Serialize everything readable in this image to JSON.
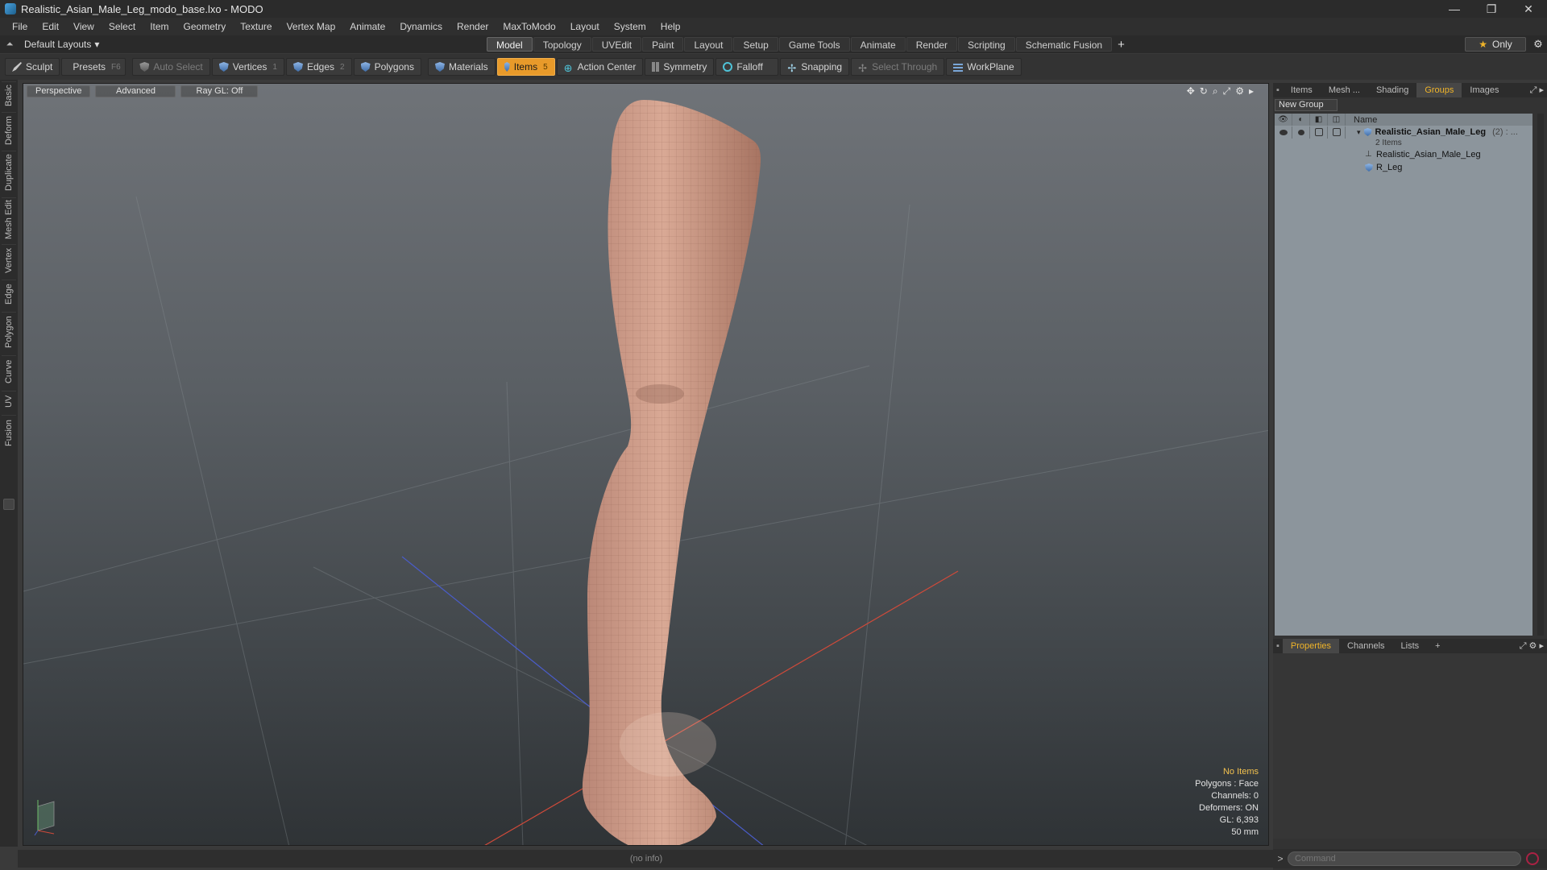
{
  "window": {
    "title": "Realistic_Asian_Male_Leg_modo_base.lxo - MODO",
    "controls": {
      "minimize": "—",
      "maximize": "❐",
      "close": "✕"
    }
  },
  "menu": [
    "File",
    "Edit",
    "View",
    "Select",
    "Item",
    "Geometry",
    "Texture",
    "Vertex Map",
    "Animate",
    "Dynamics",
    "Render",
    "MaxToModo",
    "Layout",
    "System",
    "Help"
  ],
  "layoutbar": {
    "layout_select": "Default Layouts",
    "tabs": [
      "Model",
      "Topology",
      "UVEdit",
      "Paint",
      "Layout",
      "Setup",
      "Game Tools",
      "Animate",
      "Render",
      "Scripting",
      "Schematic Fusion"
    ],
    "active_tab": "Model",
    "add_tab": "+",
    "only_label": "Only"
  },
  "toolbar": {
    "sculpt": "Sculpt",
    "presets": "Presets",
    "presets_key": "F6",
    "auto_select": "Auto Select",
    "vertices": "Vertices",
    "vertices_key": "1",
    "edges": "Edges",
    "edges_key": "2",
    "polygons": "Polygons",
    "materials": "Materials",
    "items": "Items",
    "items_key": "5",
    "action_center": "Action Center",
    "symmetry": "Symmetry",
    "falloff": "Falloff",
    "snapping": "Snapping",
    "select_through": "Select Through",
    "workplane": "WorkPlane"
  },
  "left_tabs": [
    "Basic",
    "Deform",
    "Duplicate",
    "Mesh Edit",
    "Vertex",
    "Edge",
    "Polygon",
    "Curve",
    "UV",
    "Fusion"
  ],
  "viewport": {
    "view_mode": "Perspective",
    "shading": "Advanced",
    "raygl": "Ray GL: Off",
    "info": {
      "selection": "No Items",
      "polygons": "Polygons : Face",
      "channels": "Channels: 0",
      "deformers": "Deformers: ON",
      "gl": "GL: 6,393",
      "focal": "50 mm"
    }
  },
  "statusbar": {
    "text": "(no info)"
  },
  "right_panel": {
    "top_tabs": [
      "Items",
      "Mesh ...",
      "Shading",
      "Groups",
      "Images"
    ],
    "active_top_tab": "Groups",
    "new_group": "New Group",
    "list_header_name": "Name",
    "groups": [
      {
        "name": "Realistic_Asian_Male_Leg",
        "count": "(2) : ...",
        "sub": "2 Items",
        "children": [
          {
            "name": "Realistic_Asian_Male_Leg",
            "icon": "locator-icon"
          },
          {
            "name": "R_Leg",
            "icon": "mesh-icon"
          }
        ]
      }
    ],
    "bottom_tabs": [
      "Properties",
      "Channels",
      "Lists"
    ],
    "active_bottom_tab": "Properties",
    "command_placeholder": "Command",
    "command_prompt": ">"
  },
  "colors": {
    "accent": "#e89a2a",
    "active_tab_text": "#f0b429",
    "list_bg": "#8c959c",
    "viewport_top": "#6f7378",
    "viewport_bottom": "#2f3336"
  }
}
